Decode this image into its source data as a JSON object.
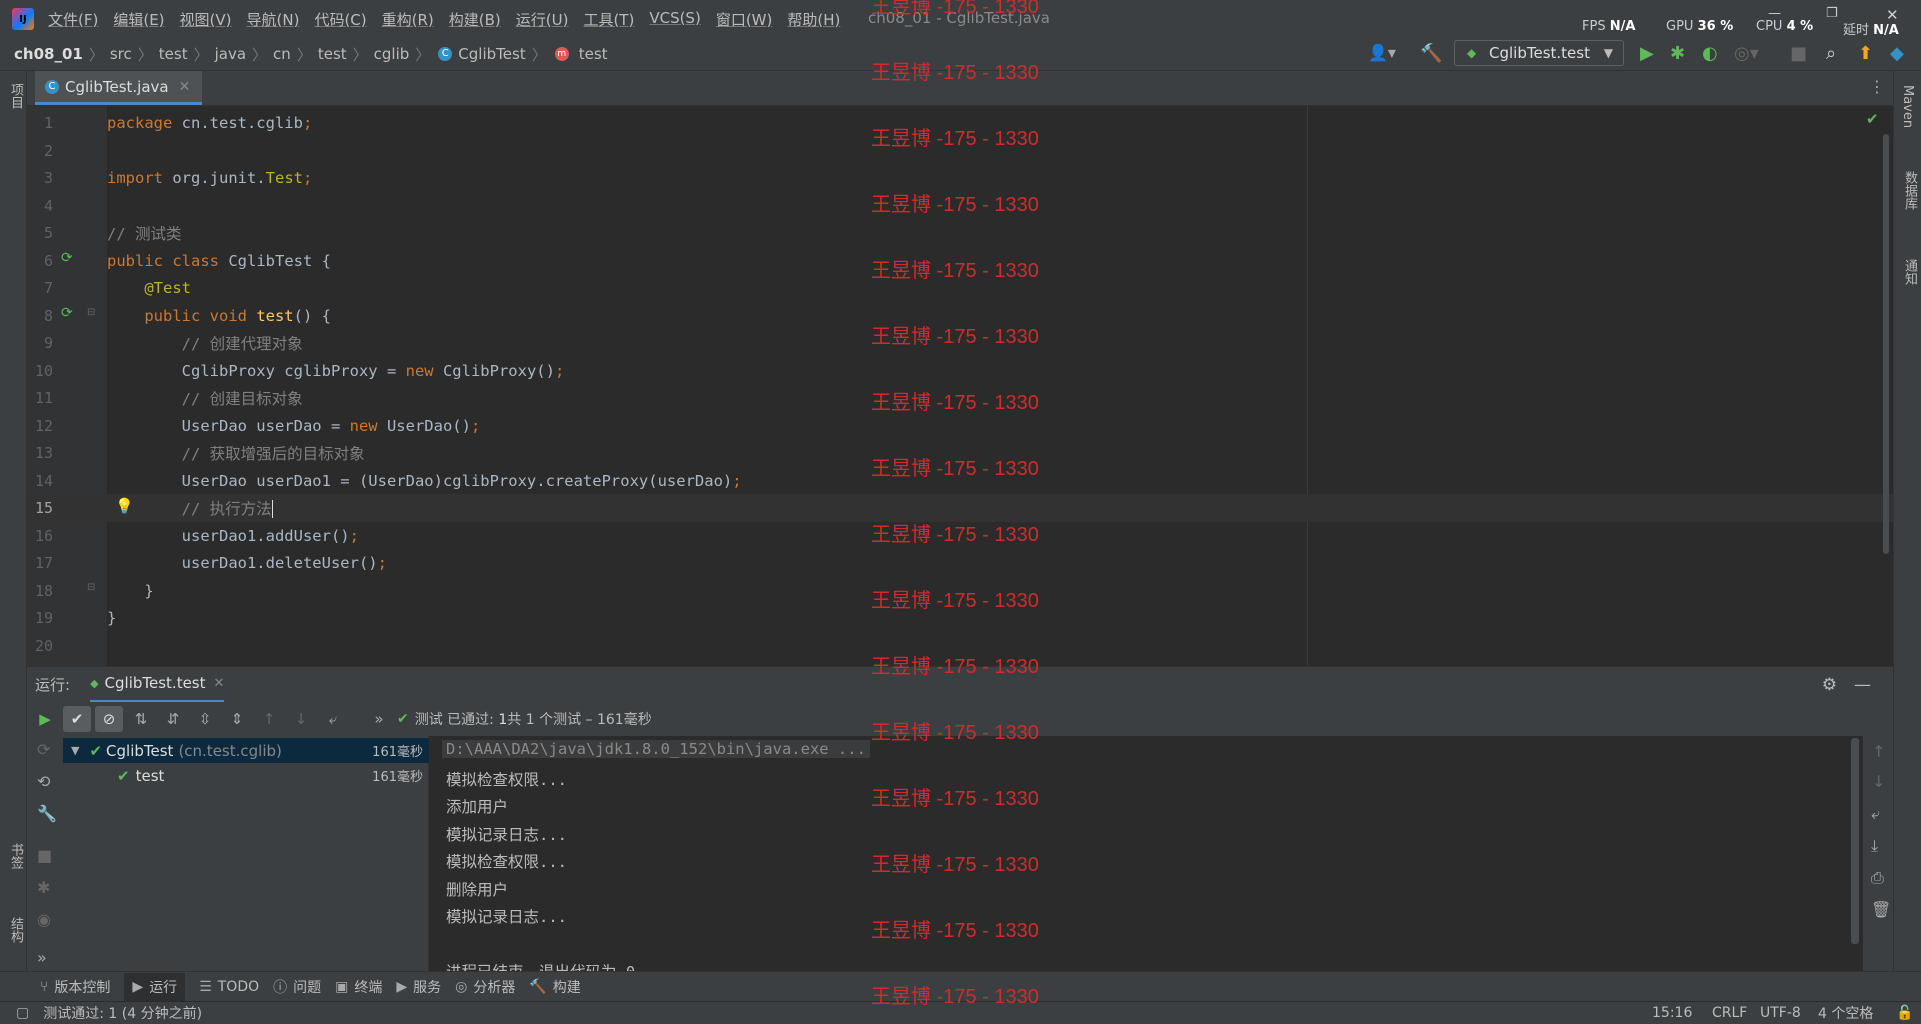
{
  "window": {
    "title": "ch08_01 - CglibTest.java"
  },
  "menu": [
    "文件(F)",
    "编辑(E)",
    "视图(V)",
    "导航(N)",
    "代码(C)",
    "重构(R)",
    "构建(B)",
    "运行(U)",
    "工具(T)",
    "VCS(S)",
    "窗口(W)",
    "帮助(H)"
  ],
  "perf": {
    "fps_label": "FPS",
    "fps": "N/A",
    "gpu_label": "GPU",
    "gpu": "36 %",
    "cpu_label": "CPU",
    "cpu": "4 %",
    "latency_label": "延时",
    "latency": "N/A"
  },
  "breadcrumb": [
    "ch08_01",
    "src",
    "test",
    "java",
    "cn",
    "test",
    "cglib",
    "CglibTest",
    "test"
  ],
  "run_config": "CglibTest.test",
  "left_strip": {
    "project": "项目",
    "bookmarks": "书签",
    "structure": "结构"
  },
  "right_strip": {
    "maven": "Maven",
    "database": "数据库",
    "notifications": "通知"
  },
  "editor": {
    "tab": "CglibTest.java",
    "lines": [
      {
        "n": "1",
        "parts": [
          [
            "kw",
            "package "
          ],
          [
            "cls",
            "cn.test.cglib"
          ],
          [
            "kw",
            ";"
          ]
        ]
      },
      {
        "n": "2",
        "parts": []
      },
      {
        "n": "3",
        "parts": [
          [
            "kw",
            "import "
          ],
          [
            "cls",
            "org.junit."
          ],
          [
            "ann",
            "Test"
          ],
          [
            "kw",
            ";"
          ]
        ]
      },
      {
        "n": "4",
        "parts": []
      },
      {
        "n": "5",
        "parts": [
          [
            "cmt",
            "// 测试类"
          ]
        ]
      },
      {
        "n": "6",
        "parts": [
          [
            "kw",
            "public class "
          ],
          [
            "cls",
            "CglibTest {"
          ]
        ]
      },
      {
        "n": "7",
        "parts": [
          [
            "cls",
            "    "
          ],
          [
            "ann",
            "@Test"
          ]
        ]
      },
      {
        "n": "8",
        "parts": [
          [
            "cls",
            "    "
          ],
          [
            "kw",
            "public void "
          ],
          [
            "fn",
            "test"
          ],
          [
            "cls",
            "() {"
          ]
        ]
      },
      {
        "n": "9",
        "parts": [
          [
            "cls",
            "        "
          ],
          [
            "cmt",
            "// 创建代理对象"
          ]
        ]
      },
      {
        "n": "10",
        "parts": [
          [
            "cls",
            "        CglibProxy cglibProxy = "
          ],
          [
            "kw",
            "new "
          ],
          [
            "cls",
            "CglibProxy()"
          ],
          [
            "kw",
            ";"
          ]
        ]
      },
      {
        "n": "11",
        "parts": [
          [
            "cls",
            "        "
          ],
          [
            "cmt",
            "// 创建目标对象"
          ]
        ]
      },
      {
        "n": "12",
        "parts": [
          [
            "cls",
            "        UserDao userDao = "
          ],
          [
            "kw",
            "new "
          ],
          [
            "cls",
            "UserDao()"
          ],
          [
            "kw",
            ";"
          ]
        ]
      },
      {
        "n": "13",
        "parts": [
          [
            "cls",
            "        "
          ],
          [
            "cmt",
            "// 获取增强后的目标对象"
          ]
        ]
      },
      {
        "n": "14",
        "parts": [
          [
            "cls",
            "        UserDao userDao1 = (UserDao)cglibProxy.createProxy(userDao)"
          ],
          [
            "kw",
            ";"
          ]
        ]
      },
      {
        "n": "15",
        "parts": [
          [
            "cls",
            "        "
          ],
          [
            "cmt",
            "// 执行方法"
          ]
        ]
      },
      {
        "n": "16",
        "parts": [
          [
            "cls",
            "        userDao1.addUser()"
          ],
          [
            "kw",
            ";"
          ]
        ]
      },
      {
        "n": "17",
        "parts": [
          [
            "cls",
            "        userDao1.deleteUser()"
          ],
          [
            "kw",
            ";"
          ]
        ]
      },
      {
        "n": "18",
        "parts": [
          [
            "cls",
            "    }"
          ]
        ]
      },
      {
        "n": "19",
        "parts": [
          [
            "cls",
            "}"
          ]
        ]
      },
      {
        "n": "20",
        "parts": []
      }
    ]
  },
  "run_panel": {
    "label": "运行:",
    "tab": "CglibTest.test",
    "status_prefix": "测试 已通过:",
    "status_count": "1",
    "status_suffix": "共 1 个测试 – 161毫秒",
    "tree": [
      {
        "name": "CglibTest",
        "pkg": "(cn.test.cglib)",
        "time": "161毫秒"
      },
      {
        "name": "test",
        "pkg": "",
        "time": "161毫秒"
      }
    ],
    "console": [
      "D:\\AAA\\DA2\\java\\jdk1.8.0_152\\bin\\java.exe ...",
      "模拟检查权限...",
      "添加用户",
      "模拟记录日志...",
      "模拟检查权限...",
      "删除用户",
      "模拟记录日志...",
      "",
      "进程已结束，退出代码为 0"
    ]
  },
  "bottom_tabs": [
    "版本控制",
    "运行",
    "TODO",
    "问题",
    "终端",
    "服务",
    "分析器",
    "构建"
  ],
  "status": {
    "message": "测试通过: 1 (4 分钟之前)",
    "position": "15:16",
    "line_ending": "CRLF",
    "encoding": "UTF-8",
    "indent": "4 个空格"
  },
  "watermark": "王昱博 -175 - 1330",
  "colors": {
    "keyword": "#cc7832",
    "comment": "#808080",
    "annotation": "#bbb529",
    "method": "#ffc66d",
    "pass": "#5fb85c",
    "watermark": "#d02c2c"
  }
}
